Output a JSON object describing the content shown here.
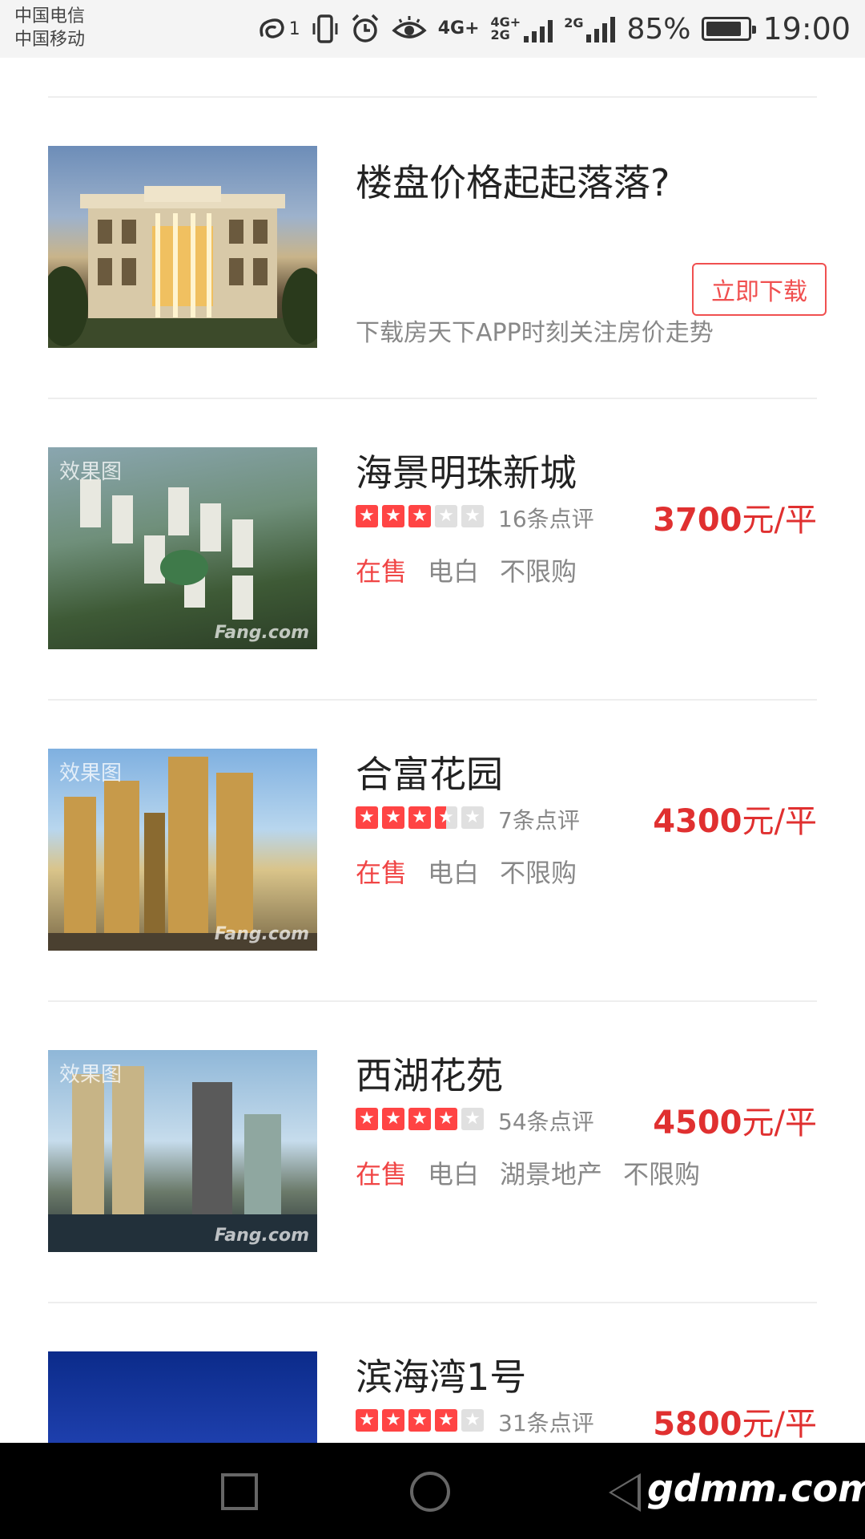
{
  "status_bar": {
    "carrier1": "中国电信",
    "carrier2": "中国移动",
    "sim_indicator": "1",
    "net1": "4G+",
    "net2_top": "4G+",
    "net2_bottom": "2G",
    "net3": "2G",
    "battery_pct_text": "85%",
    "battery_level": 0.85,
    "time": "19:00"
  },
  "ad": {
    "title": "楼盘价格起起落落?",
    "button_label": "立即下载",
    "description": "下载房天下APP时刻关注房价走势"
  },
  "listings": [
    {
      "name": "海景明珠新城",
      "image_tag": "效果图",
      "rating": 3,
      "reviews": "16条点评",
      "price_num": "3700",
      "price_unit": "元/平",
      "tags": [
        "在售",
        "电白",
        "不限购"
      ]
    },
    {
      "name": "合富花园",
      "image_tag": "效果图",
      "rating": 3.5,
      "reviews": "7条点评",
      "price_num": "4300",
      "price_unit": "元/平",
      "tags": [
        "在售",
        "电白",
        "不限购"
      ]
    },
    {
      "name": "西湖花苑",
      "image_tag": "效果图",
      "rating": 4,
      "reviews": "54条点评",
      "price_num": "4500",
      "price_unit": "元/平",
      "tags": [
        "在售",
        "电白",
        "湖景地产",
        "不限购"
      ]
    },
    {
      "name": "滨海湾1号",
      "image_tag": "",
      "rating": 4,
      "reviews": "31条点评",
      "price_num": "5800",
      "price_unit": "元/平",
      "tags": []
    }
  ],
  "image_watermark": "Fang.com",
  "nav_watermark": "gdmm.com",
  "colors": {
    "accent": "#e03030",
    "sale": "#f04545",
    "star_on": "#ff4444",
    "star_off": "#e0e0e0"
  }
}
